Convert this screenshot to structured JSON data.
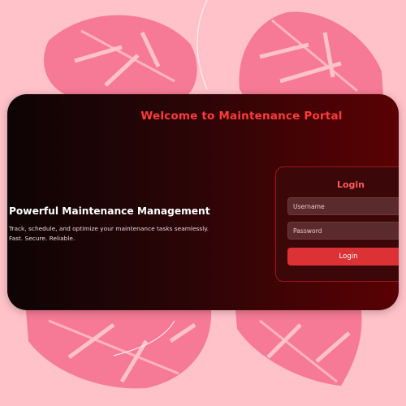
{
  "page": {
    "background": "#ffc2c9"
  },
  "header": {
    "title": "Welcome to Maintenance Portal",
    "title_color": "#ff3b3b"
  },
  "hero": {
    "heading": "Powerful Maintenance Management",
    "description": "Track, schedule, and optimize your maintenance tasks seamlessly.",
    "tagline": "Fast. Secure. Reliable."
  },
  "login": {
    "title": "Login",
    "username_placeholder": "Username",
    "password_placeholder": "Password",
    "submit_label": "Login",
    "accent_color": "#dc3135"
  },
  "decorations": {
    "leaf_color": "#f67a95",
    "leaf_icon": "monstera-leaf-icon"
  }
}
